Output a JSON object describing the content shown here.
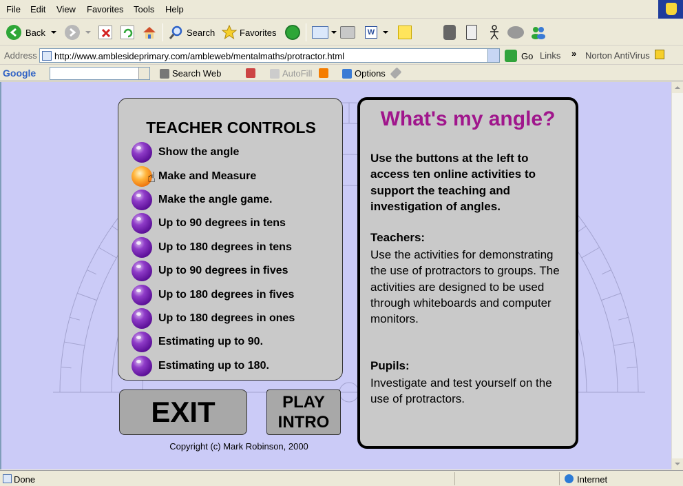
{
  "menu": [
    "File",
    "Edit",
    "View",
    "Favorites",
    "Tools",
    "Help"
  ],
  "toolbar": {
    "back": "Back",
    "search": "Search",
    "favorites": "Favorites"
  },
  "address": {
    "label": "Address",
    "url": "http://www.amblesideprimary.com/ambleweb/mentalmaths/protractor.html",
    "go": "Go",
    "links": "Links",
    "norton": "Norton AntiVirus"
  },
  "googlebar": {
    "logo": "Google",
    "search_web": "Search Web",
    "autofill": "AutoFill",
    "options": "Options"
  },
  "page": {
    "teacher_title": "TEACHER CONTROLS",
    "items": [
      "Show the angle",
      "Make  and Measure",
      "Make the angle game.",
      "Up to 90 degrees in tens",
      "Up to 180 degrees in tens",
      "Up to 90 degrees in fives",
      "Up to 180 degrees in fives",
      "Up to 180 degrees in ones",
      "Estimating up to 90.",
      "Estimating up to 180."
    ],
    "active_item": 1,
    "exit": "EXIT",
    "play": "PLAY",
    "intro": "INTRO",
    "copyright": "Copyright (c) Mark Robinson, 2000",
    "info_title": "What's my angle?",
    "info_intro": "Use the buttons at the left to access ten online activities to support the teaching and investigation of angles.",
    "teachers_heading": "Teachers:",
    "teachers_text": "Use the activities for demonstrating the use of protractors to groups. The activities are designed to be used through whiteboards and computer monitors.",
    "pupils_heading": "Pupils:",
    "pupils_text": "Investigate and test yourself on the use of protractors."
  },
  "status": {
    "text": "Done",
    "zone": "Internet"
  },
  "colors": {
    "page_bg": "#cbcbf7",
    "title_purple": "#a0168c",
    "panel_gray": "#c9c9c9"
  }
}
